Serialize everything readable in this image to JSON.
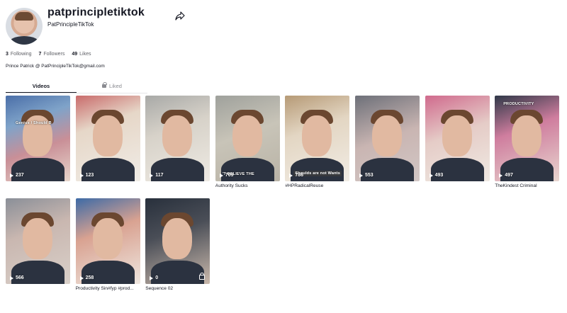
{
  "profile": {
    "username": "patprincipletiktok",
    "nickname": "PatPrincipleTikTok",
    "bio": "Prince Patrick @ PatPrincipleTikTok@gmail.com"
  },
  "stats": {
    "following_count": "3",
    "following_label": "Following",
    "followers_count": "7",
    "followers_label": "Followers",
    "likes_count": "49",
    "likes_label": "Likes"
  },
  "tabs": {
    "videos": "Videos",
    "liked": "Liked"
  },
  "colors": {
    "text": "#161823",
    "muted": "#8a8b91",
    "divider": "#e6e6e8"
  },
  "videos": [
    {
      "views": "237",
      "caption": "",
      "overlay": "Genius / Should B"
    },
    {
      "views": "123",
      "caption": "",
      "overlay": ""
    },
    {
      "views": "117",
      "caption": "",
      "overlay": ""
    },
    {
      "views": "709",
      "caption": "Authority Sucks",
      "overlay": "'T BELIEVE THE"
    },
    {
      "views": "786",
      "caption": "#HPRadicalReuse",
      "overlay": "Shoulds are not Wants"
    },
    {
      "views": "553",
      "caption": "",
      "overlay": ""
    },
    {
      "views": "493",
      "caption": "",
      "overlay": ""
    },
    {
      "views": "497",
      "caption": "TheKindest Criminal",
      "overlay": "PRODUCTIVITY"
    },
    {
      "views": "566",
      "caption": "",
      "overlay": ""
    },
    {
      "views": "258",
      "caption": "Productivity Sin#fyp #prod...",
      "overlay": ""
    },
    {
      "views": "0",
      "caption": "Sequence 02",
      "overlay": ""
    }
  ]
}
